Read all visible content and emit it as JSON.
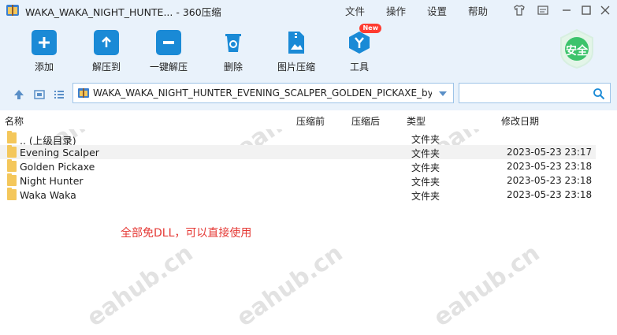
{
  "window": {
    "title": "WAKA_WAKA_NIGHT_HUNTE... - 360压缩",
    "menu": [
      "文件",
      "操作",
      "设置",
      "帮助"
    ]
  },
  "toolbar": {
    "tools": [
      {
        "label": "添加",
        "icon": "add-icon"
      },
      {
        "label": "解压到",
        "icon": "extract-to-icon"
      },
      {
        "label": "一键解压",
        "icon": "one-click-extract-icon"
      },
      {
        "label": "删除",
        "icon": "delete-icon"
      },
      {
        "label": "图片压缩",
        "icon": "image-compress-icon"
      },
      {
        "label": "工具",
        "icon": "tools-icon"
      }
    ],
    "new_badge": "New",
    "safe_label": "安全"
  },
  "nav": {
    "path": "WAKA_WAKA_NIGHT_HUNTER_EVENING_SCALPER_GOLDEN_PICKAXE_by_",
    "search_placeholder": ""
  },
  "columns": [
    "名称",
    "压缩前",
    "压缩后",
    "类型",
    "修改日期"
  ],
  "rows": [
    {
      "name": ".. (上级目录)",
      "type": "文件夹",
      "date": ""
    },
    {
      "name": "Evening Scalper",
      "type": "文件夹",
      "date": "2023-05-23 23:17"
    },
    {
      "name": "Golden Pickaxe",
      "type": "文件夹",
      "date": "2023-05-23 23:18"
    },
    {
      "name": "Night Hunter",
      "type": "文件夹",
      "date": "2023-05-23 23:18"
    },
    {
      "name": "Waka Waka",
      "type": "文件夹",
      "date": "2023-05-23 23:18"
    }
  ],
  "note": "全部免DLL，可以直接使用",
  "watermark": "eahub.cn",
  "colors": {
    "accent": "#1a8ad6",
    "note": "#e53935",
    "safe": "#3cc36b"
  }
}
